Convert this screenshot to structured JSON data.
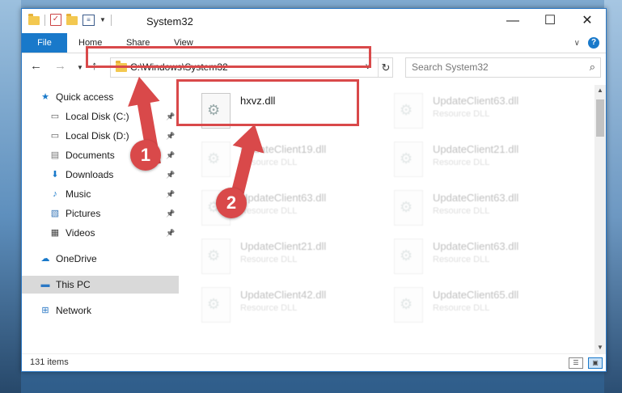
{
  "window": {
    "title": "System32"
  },
  "ribbon": {
    "tabs": [
      "File",
      "Home",
      "Share",
      "View"
    ],
    "help": "?"
  },
  "address": {
    "path": "C:\\Windows\\System32",
    "refresh": "↻"
  },
  "search": {
    "placeholder": "Search System32"
  },
  "sidebar": {
    "items": [
      {
        "label": "Quick access",
        "icon": "star-icon",
        "pinned": false
      },
      {
        "label": "Local Disk (C:)",
        "icon": "drive-icon",
        "pinned": true
      },
      {
        "label": "Local Disk (D:)",
        "icon": "drive-icon",
        "pinned": true
      },
      {
        "label": "Documents",
        "icon": "documents-icon",
        "pinned": true
      },
      {
        "label": "Downloads",
        "icon": "download-icon",
        "pinned": true
      },
      {
        "label": "Music",
        "icon": "music-icon",
        "pinned": true
      },
      {
        "label": "Pictures",
        "icon": "pictures-icon",
        "pinned": true
      },
      {
        "label": "Videos",
        "icon": "videos-icon",
        "pinned": true
      },
      {
        "label": "OneDrive",
        "icon": "cloud-icon",
        "pinned": false
      },
      {
        "label": "This PC",
        "icon": "computer-icon",
        "pinned": false,
        "selected": true
      },
      {
        "label": "Network",
        "icon": "network-icon",
        "pinned": false
      }
    ]
  },
  "files": {
    "primary": {
      "name": "hxvz.dll",
      "type": ""
    },
    "left_column": [
      {
        "name": "UpdateClient19.dll",
        "type": "Resource DLL"
      },
      {
        "name": "UpdateClient63.dll",
        "type": "Resource DLL"
      },
      {
        "name": "UpdateClient21.dll",
        "type": "Resource DLL"
      },
      {
        "name": "UpdateClient42.dll",
        "type": "Resource DLL"
      }
    ],
    "right_column": [
      {
        "name": "UpdateClient63.dll",
        "type": "Resource DLL"
      },
      {
        "name": "UpdateClient21.dll",
        "type": "Resource DLL"
      },
      {
        "name": "UpdateClient63.dll",
        "type": "Resource DLL"
      },
      {
        "name": "UpdateClient63.dll",
        "type": "Resource DLL"
      },
      {
        "name": "UpdateClient65.dll",
        "type": "Resource DLL"
      }
    ]
  },
  "status": {
    "items_count": "131 items"
  },
  "annotations": {
    "step1": "1",
    "step2": "2",
    "color": "#d9494a"
  }
}
